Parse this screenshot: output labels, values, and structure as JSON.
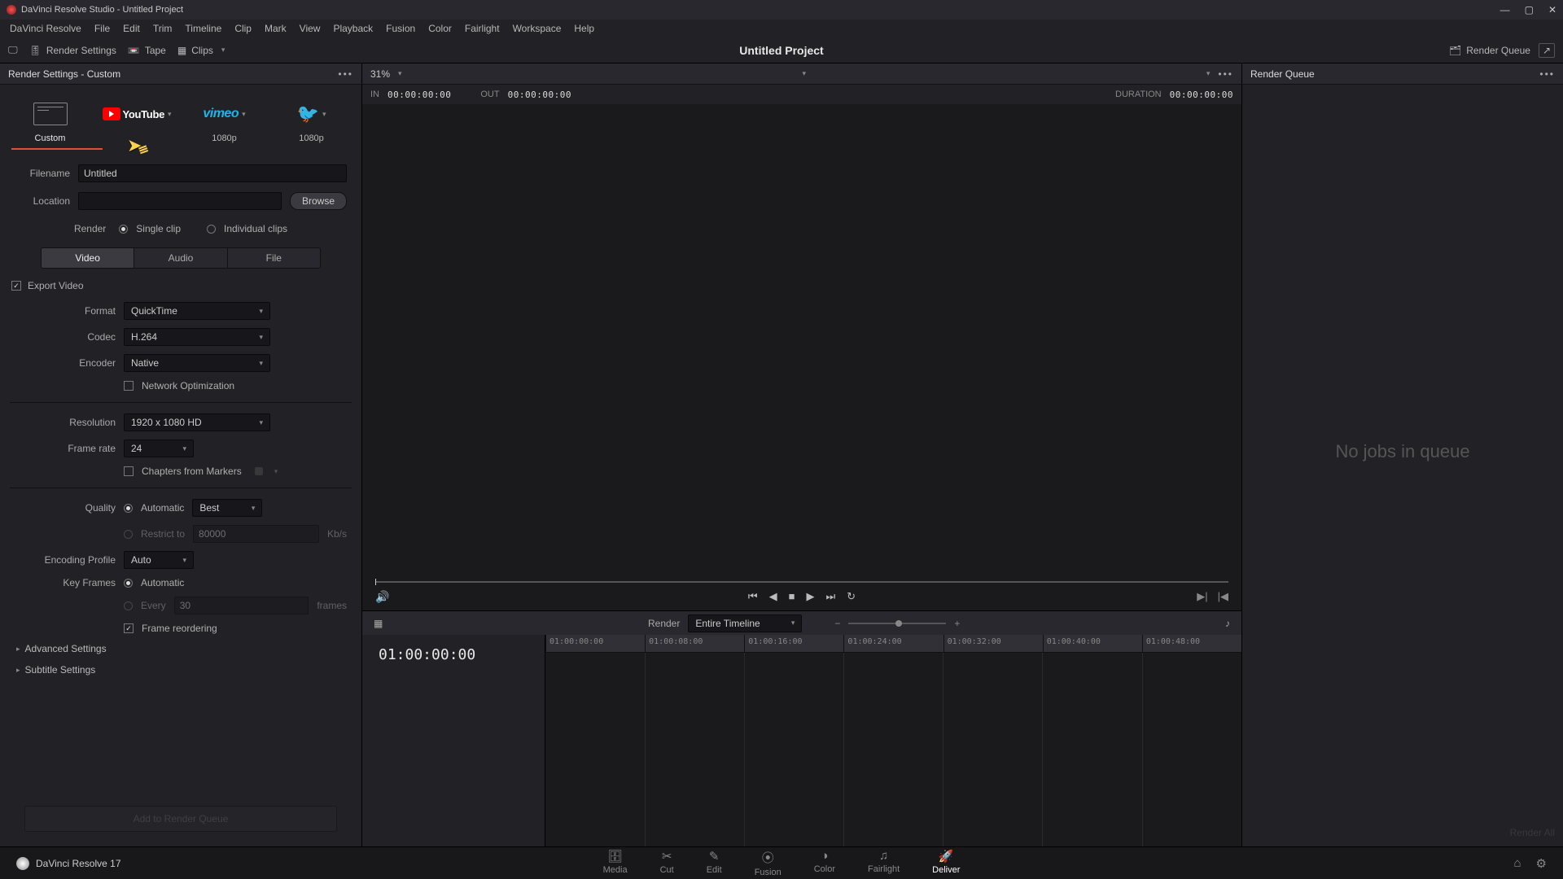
{
  "titlebar": {
    "title": "DaVinci Resolve Studio - Untitled Project"
  },
  "menubar": [
    "DaVinci Resolve",
    "File",
    "Edit",
    "Trim",
    "Timeline",
    "Clip",
    "Mark",
    "View",
    "Playback",
    "Fusion",
    "Color",
    "Fairlight",
    "Workspace",
    "Help"
  ],
  "toolbar": {
    "render_settings": "Render Settings",
    "tape": "Tape",
    "clips": "Clips",
    "project": "Untitled Project",
    "render_queue": "Render Queue"
  },
  "left": {
    "header": "Render Settings - Custom",
    "presets": {
      "custom": "Custom",
      "youtube": "YouTube",
      "vimeo": "vimeo",
      "p1080": "1080p"
    },
    "filename_label": "Filename",
    "filename_value": "Untitled",
    "location_label": "Location",
    "location_value": "",
    "browse": "Browse",
    "render_label": "Render",
    "single_clip": "Single clip",
    "individual_clips": "Individual clips",
    "tabs": {
      "video": "Video",
      "audio": "Audio",
      "file": "File"
    },
    "export_video": "Export Video",
    "format_label": "Format",
    "format_value": "QuickTime",
    "codec_label": "Codec",
    "codec_value": "H.264",
    "encoder_label": "Encoder",
    "encoder_value": "Native",
    "network_opt": "Network Optimization",
    "resolution_label": "Resolution",
    "resolution_value": "1920 x 1080 HD",
    "framerate_label": "Frame rate",
    "framerate_value": "24",
    "chapters": "Chapters from Markers",
    "quality_label": "Quality",
    "quality_auto": "Automatic",
    "quality_best": "Best",
    "restrict_to": "Restrict to",
    "restrict_val": "80000",
    "restrict_unit": "Kb/s",
    "encprofile_label": "Encoding Profile",
    "encprofile_value": "Auto",
    "keyframes_label": "Key Frames",
    "keyframes_auto": "Automatic",
    "keyframes_every": "Every",
    "keyframes_n": "30",
    "keyframes_unit": "frames",
    "frame_reorder": "Frame reordering",
    "advanced": "Advanced Settings",
    "subtitle": "Subtitle Settings",
    "add_to_queue": "Add to Render Queue"
  },
  "viewer": {
    "zoom": "31%",
    "in_label": "IN",
    "in_val": "00:00:00:00",
    "out_label": "OUT",
    "out_val": "00:00:00:00",
    "duration_label": "DURATION",
    "duration_val": "00:00:00:00"
  },
  "timeline": {
    "render_label": "Render",
    "scope": "Entire Timeline",
    "tc": "01:00:00:00",
    "ticks": [
      "01:00:00:00",
      "01:00:08:00",
      "01:00:16:00",
      "01:00:24:00",
      "01:00:32:00",
      "01:00:40:00",
      "01:00:48:00"
    ]
  },
  "queue": {
    "header": "Render Queue",
    "empty": "No jobs in queue",
    "render_all": "Render All"
  },
  "pagebar": {
    "product": "DaVinci Resolve 17",
    "pages": [
      "Media",
      "Cut",
      "Edit",
      "Fusion",
      "Color",
      "Fairlight",
      "Deliver"
    ]
  }
}
